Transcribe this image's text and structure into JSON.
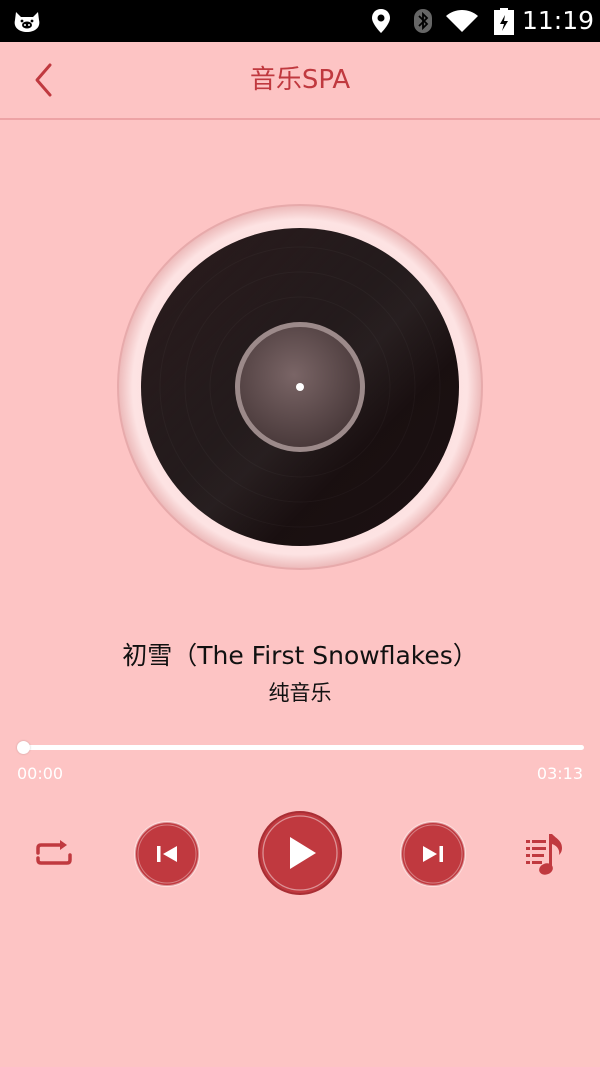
{
  "status_bar": {
    "time": "11:19",
    "icons": [
      "app-pig-icon",
      "location-icon",
      "bluetooth-icon",
      "wifi-icon",
      "battery-charging-icon"
    ]
  },
  "header": {
    "title": "音乐SPA",
    "back_icon": "chevron-left-icon"
  },
  "player": {
    "song_title": "初雪（The First Snowflakes）",
    "artist": "纯音乐",
    "current_time": "00:00",
    "total_time": "03:13",
    "progress_fraction": 0
  },
  "controls": {
    "icons": [
      "repeat-icon",
      "previous-icon",
      "play-icon",
      "next-icon",
      "playlist-icon"
    ]
  },
  "colors": {
    "background": "#fdc4c4",
    "accent": "#c0393f",
    "status_bar": "#000000"
  }
}
